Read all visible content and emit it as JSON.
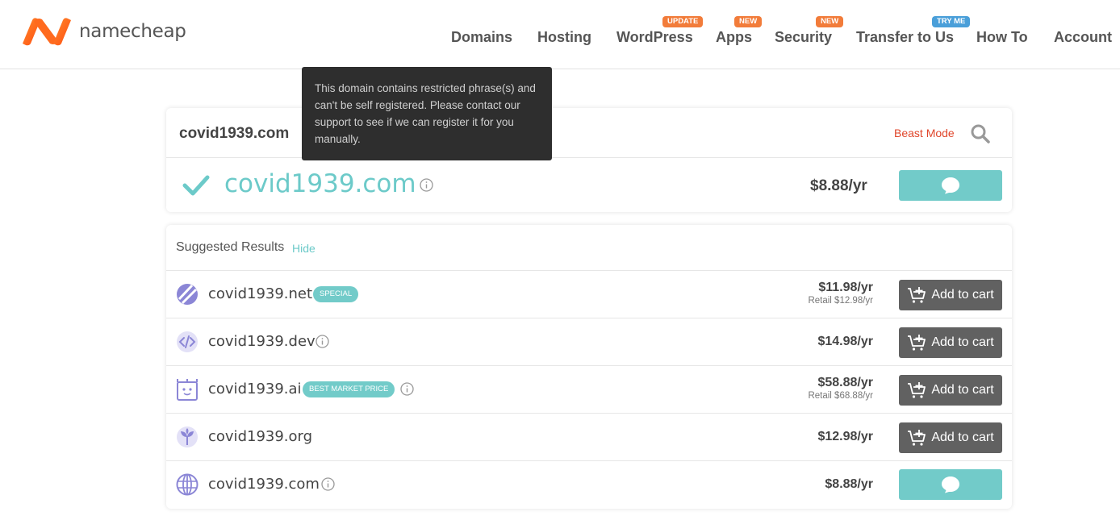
{
  "brand": {
    "name": "namecheap"
  },
  "nav": [
    {
      "label": "Domains",
      "badge": ""
    },
    {
      "label": "Hosting",
      "badge": ""
    },
    {
      "label": "WordPress",
      "badge": "UPDATE"
    },
    {
      "label": "Apps",
      "badge": "NEW"
    },
    {
      "label": "Security",
      "badge": "NEW"
    },
    {
      "label": "Transfer to Us",
      "badge": "TRY ME"
    },
    {
      "label": "How To",
      "badge": ""
    },
    {
      "label": "Account",
      "badge": ""
    }
  ],
  "search": {
    "query": "covid1939.com",
    "beast_mode": "Beast Mode"
  },
  "tooltip": {
    "text": "This domain contains restricted phrase(s) and can't be self registered. Please contact our support to see if we can register it for you manually."
  },
  "main_result": {
    "domain": "covid1939.com",
    "price": "$8.88/yr"
  },
  "suggested": {
    "title": "Suggested Results",
    "hide": "Hide",
    "rows": [
      {
        "domain": "covid1939.net",
        "pill": "SPECIAL",
        "price": "$11.98/yr",
        "retail": "Retail $12.98/yr",
        "action": "Add to cart"
      },
      {
        "domain": "covid1939.dev",
        "pill": "",
        "price": "$14.98/yr",
        "retail": "",
        "action": "Add to cart"
      },
      {
        "domain": "covid1939.ai",
        "pill": "BEST MARKET PRICE",
        "price": "$58.88/yr",
        "retail": "Retail $68.88/yr",
        "action": "Add to cart"
      },
      {
        "domain": "covid1939.org",
        "pill": "",
        "price": "$12.98/yr",
        "retail": "",
        "action": "Add to cart"
      },
      {
        "domain": "covid1939.com",
        "pill": "",
        "price": "$8.88/yr",
        "retail": "",
        "action": ""
      }
    ]
  },
  "colors": {
    "brand_orange": "#ff5e1a",
    "teal": "#72cbc9",
    "beast_red": "#e0462b",
    "cart_gray": "#616161",
    "tld_purple": "#8b86d6"
  }
}
